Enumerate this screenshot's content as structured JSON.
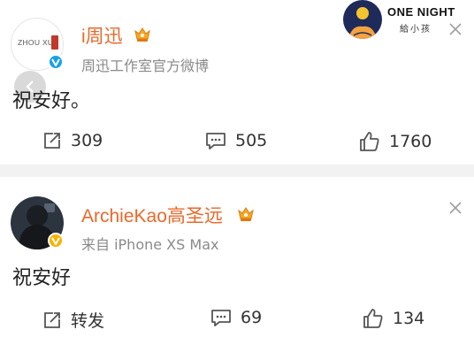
{
  "badge": {
    "title": "ONE NIGHT",
    "subtitle": "給小孩"
  },
  "posts": [
    {
      "avatar_text": "ZHOU XUN",
      "name": "i周迅",
      "source": "周迅工作室官方微博",
      "content": "祝安好。",
      "repost": "309",
      "comment": "505",
      "like": "1760",
      "name_color": "#e8692b",
      "verify_color": "#1aa0e8"
    },
    {
      "name": "ArchieKao高圣远",
      "source": "来自 iPhone XS Max",
      "content": "祝安好",
      "repost": "转发",
      "comment": "69",
      "like": "134",
      "name_color": "#e8692b",
      "verify_color": "#f5b400"
    }
  ]
}
